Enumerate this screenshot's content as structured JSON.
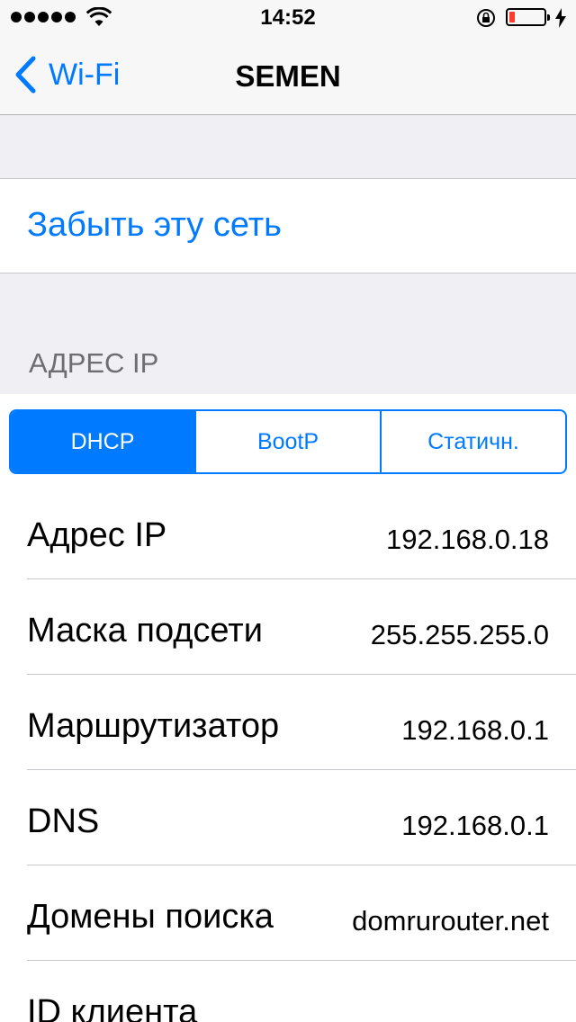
{
  "status_bar": {
    "time": "14:52",
    "signal_bars": 5,
    "battery_level": 0.15
  },
  "nav": {
    "back_label": "Wi-Fi",
    "title": "SEMEN"
  },
  "forget_network": "Забыть эту сеть",
  "ip_section": {
    "header": "АДРЕС IP",
    "segments": [
      "DHCP",
      "BootP",
      "Статичн."
    ],
    "selected": "DHCP"
  },
  "rows": [
    {
      "label": "Адрес IP",
      "value": "192.168.0.18"
    },
    {
      "label": "Маска подсети",
      "value": "255.255.255.0"
    },
    {
      "label": "Маршрутизатор",
      "value": "192.168.0.1"
    },
    {
      "label": "DNS",
      "value": "192.168.0.1"
    },
    {
      "label": "Домены поиска",
      "value": "domrurouter.net"
    },
    {
      "label": "ID клиента",
      "value": ""
    }
  ],
  "colors": {
    "accent": "#007aff",
    "battery_low": "#ff3b30"
  }
}
